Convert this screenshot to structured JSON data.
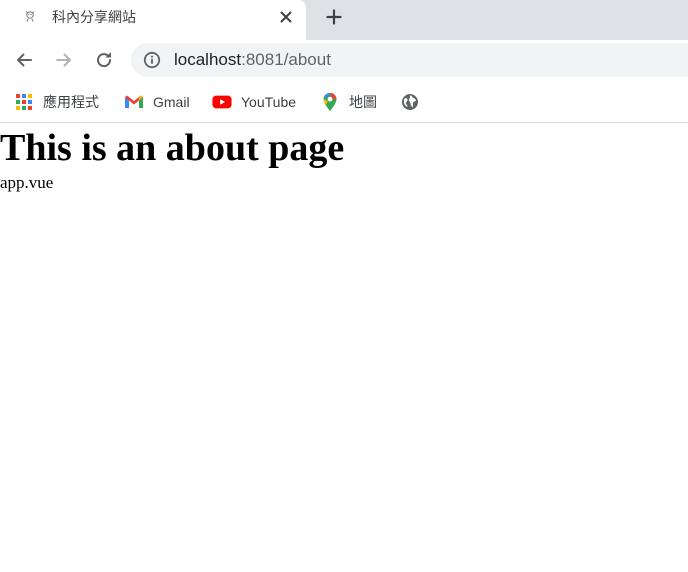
{
  "tab": {
    "title": "科內分享網站",
    "close_icon": "close-icon",
    "new_tab_icon": "plus-icon"
  },
  "toolbar": {
    "url_host": "localhost",
    "url_rest": ":8081/about"
  },
  "bookmarks": [
    {
      "label": "應用程式",
      "icon": "apps-grid-icon"
    },
    {
      "label": "Gmail",
      "icon": "gmail-icon"
    },
    {
      "label": "YouTube",
      "icon": "youtube-icon"
    },
    {
      "label": "地圖",
      "icon": "maps-pin-icon"
    },
    {
      "label": "",
      "icon": "globe-icon"
    }
  ],
  "page": {
    "heading": "This is an about page",
    "subtext": "app.vue"
  },
  "colors": {
    "tabstrip_bg": "#dee1e6",
    "omnibox_bg": "#f1f3f4",
    "youtube_red": "#ff0000"
  }
}
